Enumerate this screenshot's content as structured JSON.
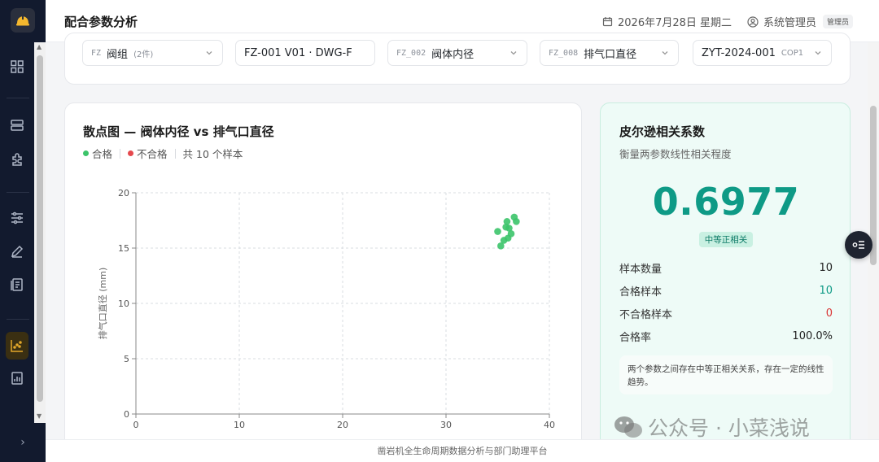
{
  "header": {
    "title": "配合参数分析",
    "date": "2026年7月28日 星期二",
    "user": "系统管理员",
    "role": "管理员"
  },
  "filters": [
    {
      "code": "FZ",
      "label": "阀组",
      "sub": "(2件)"
    },
    {
      "code": "",
      "label": "FZ-001 V01 · DWG-F",
      "sub": ""
    },
    {
      "code": "FZ_002",
      "label": "阀体内径",
      "sub": ""
    },
    {
      "code": "FZ_008",
      "label": "排气口直径",
      "sub": ""
    },
    {
      "code": "",
      "label": "ZYT-2024-001",
      "sub": "COP1"
    }
  ],
  "scatter": {
    "title": "散点图 — 阀体内径 vs 排气口直径",
    "legend_pass": "合格",
    "legend_fail": "不合格",
    "sample_count_text": "共 10 个样本"
  },
  "chart_data": {
    "type": "scatter",
    "ylabel": "排气口直径 (mm)",
    "xlabel": "",
    "xlim": [
      0,
      40
    ],
    "ylim": [
      0,
      20
    ],
    "xticks": [
      "0",
      "10",
      "20",
      "30",
      "40"
    ],
    "yticks": [
      "0",
      "5",
      "10",
      "15",
      "20"
    ],
    "grid": true,
    "series": [
      {
        "name": "合格",
        "color": "#3cc46a",
        "points": [
          {
            "x": 35.0,
            "y": 16.5
          },
          {
            "x": 35.3,
            "y": 15.2
          },
          {
            "x": 35.6,
            "y": 15.7
          },
          {
            "x": 35.8,
            "y": 16.9
          },
          {
            "x": 35.9,
            "y": 17.4
          },
          {
            "x": 36.0,
            "y": 15.9
          },
          {
            "x": 36.1,
            "y": 16.8
          },
          {
            "x": 36.3,
            "y": 16.3
          },
          {
            "x": 36.6,
            "y": 17.8
          },
          {
            "x": 36.8,
            "y": 17.4
          }
        ]
      },
      {
        "name": "不合格",
        "color": "#e5484d",
        "points": []
      }
    ]
  },
  "pearson": {
    "title": "皮尔逊相关系数",
    "subtitle": "衡量两参数线性相关程度",
    "value": "0.6977",
    "badge": "中等正相关",
    "stats": [
      {
        "label": "样本数量",
        "value": "10",
        "color": "#222222"
      },
      {
        "label": "合格样本",
        "value": "10",
        "color": "#0e9a86"
      },
      {
        "label": "不合格样本",
        "value": "0",
        "color": "#d93636"
      },
      {
        "label": "合格率",
        "value": "100.0%",
        "color": "#222222"
      }
    ],
    "note": "两个参数之间存在中等正相关关系，存在一定的线性趋势。"
  },
  "watermark": "公众号 · 小菜浅说",
  "footer": "凿岩机全生命周期数据分析与部门助理平台",
  "colors": {
    "accent": "#0e9a86",
    "pass": "#3cc46a",
    "fail": "#e5484d",
    "sidebar": "#121a2e"
  }
}
